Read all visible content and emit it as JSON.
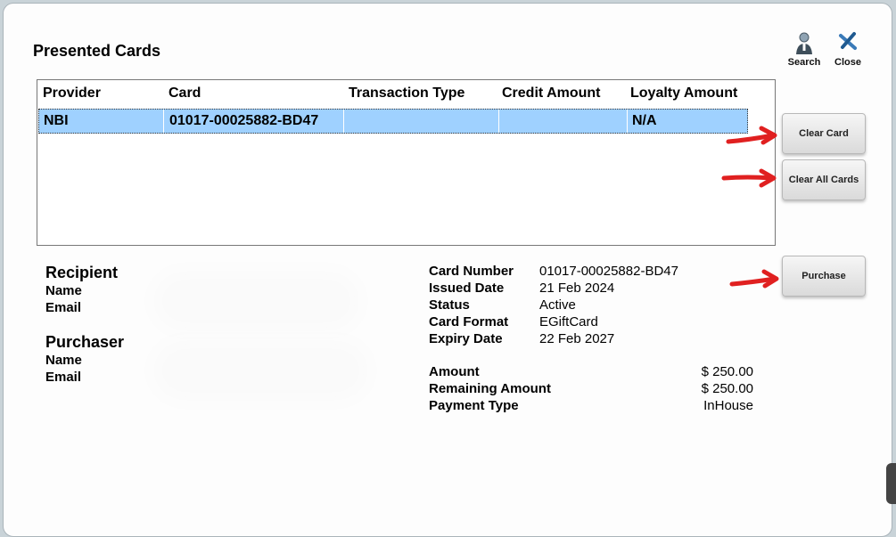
{
  "dialog": {
    "title": "Presented Cards",
    "toolbar": {
      "search_label": "Search",
      "close_label": "Close"
    }
  },
  "table": {
    "columns": [
      "Provider",
      "Card",
      "Transaction Type",
      "Credit Amount",
      "Loyalty Amount"
    ],
    "rows": [
      {
        "provider": "NBI",
        "card": "01017-00025882-BD47",
        "transaction_type": "",
        "credit_amount": "",
        "loyalty_amount": "N/A"
      }
    ]
  },
  "actions": {
    "clear_card": "Clear Card",
    "clear_all_cards": "Clear All Cards",
    "purchase": "Purchase"
  },
  "recipient": {
    "title": "Recipient",
    "name_label": "Name",
    "email_label": "Email"
  },
  "purchaser": {
    "title": "Purchaser",
    "name_label": "Name",
    "email_label": "Email"
  },
  "card_details": {
    "card_number_label": "Card Number",
    "card_number": "01017-00025882-BD47",
    "issued_date_label": "Issued Date",
    "issued_date": "21 Feb 2024",
    "status_label": "Status",
    "status": "Active",
    "card_format_label": "Card Format",
    "card_format": "EGiftCard",
    "expiry_date_label": "Expiry Date",
    "expiry_date": "22 Feb 2027"
  },
  "amounts": {
    "amount_label": "Amount",
    "amount": "$ 250.00",
    "remaining_label": "Remaining Amount",
    "remaining": "$ 250.00",
    "payment_type_label": "Payment Type",
    "payment_type": "InHouse"
  },
  "colors": {
    "selected_row": "#9fd1ff",
    "annotation_arrow": "#e02020"
  }
}
